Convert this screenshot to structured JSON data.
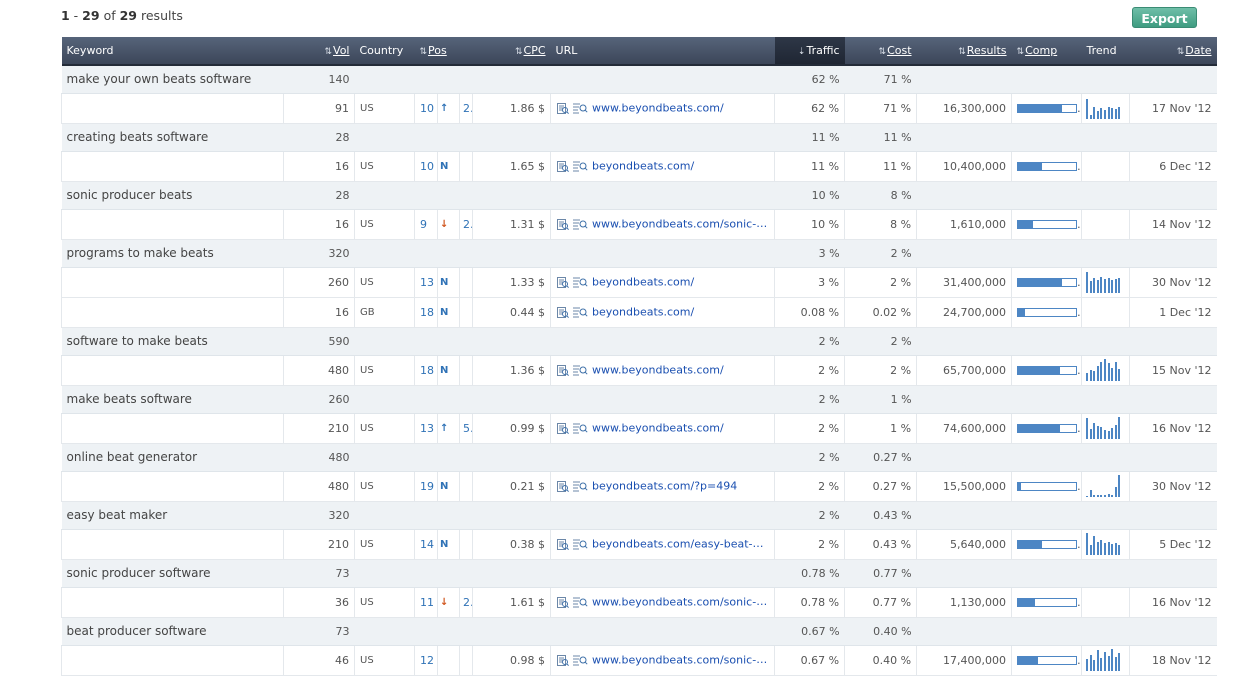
{
  "summary": {
    "from": "1",
    "to": "29",
    "of_label": "of",
    "total": "29",
    "suffix": "results"
  },
  "export_label": "Export",
  "columns": {
    "keyword": "Keyword",
    "vol": "Vol",
    "country": "Country",
    "pos": "Pos",
    "cpc": "CPC",
    "url": "URL",
    "traffic": "Traffic",
    "cost": "Cost",
    "results": "Results",
    "comp": "Comp",
    "trend": "Trend",
    "date": "Date"
  },
  "colors": {
    "header_bg": "#3c4659",
    "accent_blue": "#4d86c4",
    "link": "#1a4fb0",
    "pos_down": "#d0561e",
    "export_green": "#3f9c81"
  },
  "keywords": [
    {
      "keyword": "make your own beats software",
      "vol": "140",
      "traffic": "62 %",
      "cost": "71 %",
      "rows": [
        {
          "vol": "91",
          "country": "US",
          "pos": "10",
          "pos_arrow": "↑",
          "pos_dir": "up",
          "pos_change": "2",
          "cpc": "1.86 $",
          "url": "www.beyondbeats.com/",
          "traffic": "62 %",
          "cost": "71 %",
          "results": "16,300,000",
          "comp": 0.75,
          "trend": [
            0.9,
            0.2,
            0.55,
            0.35,
            0.5,
            0.4,
            0.55,
            0.5,
            0.45,
            0.55
          ],
          "date": "17 Nov '12"
        }
      ]
    },
    {
      "keyword": "creating beats software",
      "vol": "28",
      "traffic": "11 %",
      "cost": "11 %",
      "rows": [
        {
          "vol": "16",
          "country": "US",
          "pos": "10",
          "pos_arrow": "N",
          "pos_dir": "new",
          "pos_change": "",
          "cpc": "1.65 $",
          "url": "beyondbeats.com/",
          "traffic": "11 %",
          "cost": "11 %",
          "results": "10,400,000",
          "comp": 0.42,
          "trend": [],
          "date": "6 Dec '12"
        }
      ]
    },
    {
      "keyword": "sonic producer beats",
      "vol": "28",
      "traffic": "10 %",
      "cost": "8 %",
      "rows": [
        {
          "vol": "16",
          "country": "US",
          "pos": "9",
          "pos_arrow": "↓",
          "pos_dir": "down",
          "pos_change": "2",
          "cpc": "1.31 $",
          "url": "www.beyondbeats.com/sonic-pro...",
          "traffic": "10 %",
          "cost": "8 %",
          "results": "1,610,000",
          "comp": 0.25,
          "trend": [],
          "date": "14 Nov '12"
        }
      ]
    },
    {
      "keyword": "programs to make beats",
      "vol": "320",
      "traffic": "3 %",
      "cost": "2 %",
      "rows": [
        {
          "vol": "260",
          "country": "US",
          "pos": "13",
          "pos_arrow": "N",
          "pos_dir": "new",
          "pos_change": "",
          "cpc": "1.33 $",
          "url": "beyondbeats.com/",
          "traffic": "3 %",
          "cost": "2 %",
          "results": "31,400,000",
          "comp": 0.75,
          "trend": [
            0.95,
            0.55,
            0.7,
            0.6,
            0.75,
            0.65,
            0.7,
            0.6,
            0.65,
            0.7
          ],
          "date": "30 Nov '12"
        },
        {
          "vol": "16",
          "country": "GB",
          "pos": "18",
          "pos_arrow": "N",
          "pos_dir": "new",
          "pos_change": "",
          "cpc": "0.44 $",
          "url": "beyondbeats.com/",
          "traffic": "0.08 %",
          "cost": "0.02 %",
          "results": "24,700,000",
          "comp": 0.12,
          "trend": [],
          "date": "1 Dec '12"
        }
      ]
    },
    {
      "keyword": "software to make beats",
      "vol": "590",
      "traffic": "2 %",
      "cost": "2 %",
      "rows": [
        {
          "vol": "480",
          "country": "US",
          "pos": "18",
          "pos_arrow": "N",
          "pos_dir": "new",
          "pos_change": "",
          "cpc": "1.36 $",
          "url": "www.beyondbeats.com/",
          "traffic": "2 %",
          "cost": "2 %",
          "results": "65,700,000",
          "comp": 0.72,
          "trend": [
            0.35,
            0.5,
            0.45,
            0.7,
            0.85,
            1.0,
            0.8,
            0.6,
            0.85,
            0.55
          ],
          "date": "15 Nov '12"
        }
      ]
    },
    {
      "keyword": "make beats software",
      "vol": "260",
      "traffic": "2 %",
      "cost": "1 %",
      "rows": [
        {
          "vol": "210",
          "country": "US",
          "pos": "13",
          "pos_arrow": "↑",
          "pos_dir": "up",
          "pos_change": "5",
          "cpc": "0.99 $",
          "url": "www.beyondbeats.com/",
          "traffic": "2 %",
          "cost": "1 %",
          "results": "74,600,000",
          "comp": 0.72,
          "trend": [
            0.95,
            0.45,
            0.75,
            0.6,
            0.55,
            0.4,
            0.35,
            0.5,
            0.65,
            1.0
          ],
          "date": "16 Nov '12"
        }
      ]
    },
    {
      "keyword": "online beat generator",
      "vol": "480",
      "traffic": "2 %",
      "cost": "0.27 %",
      "rows": [
        {
          "vol": "480",
          "country": "US",
          "pos": "19",
          "pos_arrow": "N",
          "pos_dir": "new",
          "pos_change": "",
          "cpc": "0.21 $",
          "url": "beyondbeats.com/?p=494",
          "traffic": "2 %",
          "cost": "0.27 %",
          "results": "15,500,000",
          "comp": 0.05,
          "trend": [
            0,
            0.3,
            0.1,
            0.1,
            0.1,
            0.1,
            0.15,
            0.1,
            0.45,
            1.0
          ],
          "date": "30 Nov '12"
        }
      ]
    },
    {
      "keyword": "easy beat maker",
      "vol": "320",
      "traffic": "2 %",
      "cost": "0.43 %",
      "rows": [
        {
          "vol": "210",
          "country": "US",
          "pos": "14",
          "pos_arrow": "N",
          "pos_dir": "new",
          "pos_change": "",
          "cpc": "0.38 $",
          "url": "beyondbeats.com/easy-beat-mak...",
          "traffic": "2 %",
          "cost": "0.43 %",
          "results": "5,640,000",
          "comp": 0.42,
          "trend": [
            1.0,
            0.45,
            0.85,
            0.6,
            0.7,
            0.55,
            0.6,
            0.5,
            0.55,
            0.45
          ],
          "date": "5 Dec '12"
        }
      ]
    },
    {
      "keyword": "sonic producer software",
      "vol": "73",
      "traffic": "0.78 %",
      "cost": "0.77 %",
      "rows": [
        {
          "vol": "36",
          "country": "US",
          "pos": "11",
          "pos_arrow": "↓",
          "pos_dir": "down",
          "pos_change": "2",
          "cpc": "1.61 $",
          "url": "www.beyondbeats.com/sonic-pro...",
          "traffic": "0.78 %",
          "cost": "0.77 %",
          "results": "1,130,000",
          "comp": 0.3,
          "trend": [],
          "date": "16 Nov '12"
        }
      ]
    },
    {
      "keyword": "beat producer software",
      "vol": "73",
      "traffic": "0.67 %",
      "cost": "0.40 %",
      "rows": [
        {
          "vol": "46",
          "country": "US",
          "pos": "12",
          "pos_arrow": "",
          "pos_dir": "",
          "pos_change": "",
          "cpc": "0.98 $",
          "url": "www.beyondbeats.com/sonic-pro...",
          "traffic": "0.67 %",
          "cost": "0.40 %",
          "results": "17,400,000",
          "comp": 0.35,
          "trend": [
            0.55,
            0.75,
            0.5,
            0.95,
            0.6,
            0.85,
            0.7,
            1.0,
            0.65,
            0.8
          ],
          "date": "18 Nov '12"
        }
      ]
    }
  ]
}
